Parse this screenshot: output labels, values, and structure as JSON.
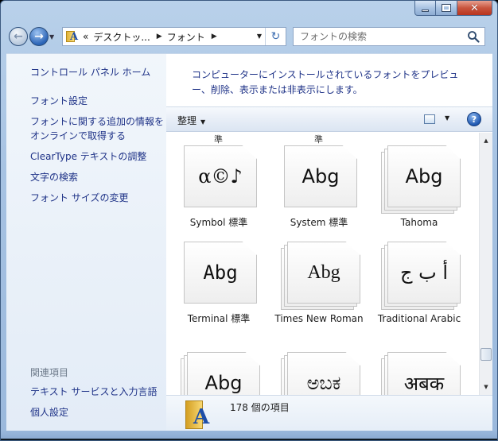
{
  "window": {
    "minimize_label": "",
    "maximize_label": "",
    "close_label": "✕"
  },
  "address": {
    "overflow": "«",
    "crumbs": [
      "デスクトッ...",
      "フォント"
    ]
  },
  "search": {
    "placeholder": "フォントの検索"
  },
  "left_pane": {
    "home": "コントロール パネル ホーム",
    "links": [
      "フォント設定",
      "フォントに関する追加の情報をオンラインで取得する",
      "ClearType テキストの調整",
      "文字の検索",
      "フォント サイズの変更"
    ],
    "see_also": "関連項目",
    "see_also_links": [
      "テキスト サービスと入力言語",
      "個人設定"
    ]
  },
  "main": {
    "description": "コンピューターにインストールされているフォントをプレビュー、削除、表示または非表示にします。",
    "toolbar": {
      "organize": "整理",
      "help": "?"
    },
    "partial_labels": [
      "準",
      "準"
    ],
    "fonts": [
      {
        "label": "Symbol 標準",
        "sample": "α©♪",
        "stacked": false,
        "family": "DejaVu Serif"
      },
      {
        "label": "System 標準",
        "sample": "Abg",
        "stacked": false,
        "family": "DejaVu Sans"
      },
      {
        "label": "Tahoma",
        "sample": "Abg",
        "stacked": true,
        "family": "DejaVu Sans"
      },
      {
        "label": "Terminal 標準",
        "sample": "Abg",
        "stacked": false,
        "family": "DejaVu Sans Mono"
      },
      {
        "label": "Times New Roman",
        "sample": "Abg",
        "stacked": true,
        "family": "Liberation Serif"
      },
      {
        "label": "Traditional Arabic",
        "sample": "أ ب ج",
        "stacked": true,
        "family": "DejaVu Sans"
      },
      {
        "label": "",
        "sample": "Abg",
        "stacked": true,
        "family": "DejaVu Sans"
      },
      {
        "label": "",
        "sample": "ಅಬಕ",
        "stacked": true,
        "family": "DejaVu Sans"
      },
      {
        "label": "",
        "sample": "अबक",
        "stacked": true,
        "family": "DejaVu Sans"
      }
    ],
    "item_count": "178 個の項目"
  },
  "scroll_position": 0.86
}
